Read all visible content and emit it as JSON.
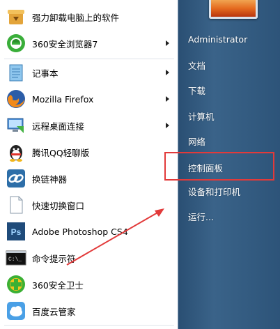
{
  "left_items": [
    {
      "label": "强力卸载电脑上的软件",
      "icon": "uninstall-icon"
    },
    {
      "label": "360安全浏览器7",
      "icon": "360-browser-icon",
      "submenu": true
    },
    {
      "label": "记事本",
      "icon": "notepad-icon",
      "submenu": true
    },
    {
      "label": "Mozilla Firefox",
      "icon": "firefox-icon",
      "submenu": true
    },
    {
      "label": "远程桌面连接",
      "icon": "remote-desktop-icon",
      "submenu": true
    },
    {
      "label": "腾讯QQ轻聊版",
      "icon": "qq-icon"
    },
    {
      "label": "换链神器",
      "icon": "link-tool-icon"
    },
    {
      "label": "快速切换窗口",
      "icon": "switch-window-icon"
    },
    {
      "label": "Adobe Photoshop CS4",
      "icon": "photoshop-icon"
    },
    {
      "label": "命令提示符",
      "icon": "cmd-icon"
    },
    {
      "label": "360安全卫士",
      "icon": "360-safe-icon"
    },
    {
      "label": "百度云管家",
      "icon": "baidu-cloud-icon"
    }
  ],
  "right_items": [
    {
      "label": "Administrator"
    },
    {
      "label": "文档"
    },
    {
      "label": "下载"
    },
    {
      "label": "计算机"
    },
    {
      "label": "网络"
    },
    {
      "label": "控制面板"
    },
    {
      "label": "设备和打印机"
    },
    {
      "label": "运行..."
    }
  ],
  "colors": {
    "highlight_box": "#e23a3a",
    "right_panel": "#3a6389",
    "arrow": "#e23a3a"
  }
}
